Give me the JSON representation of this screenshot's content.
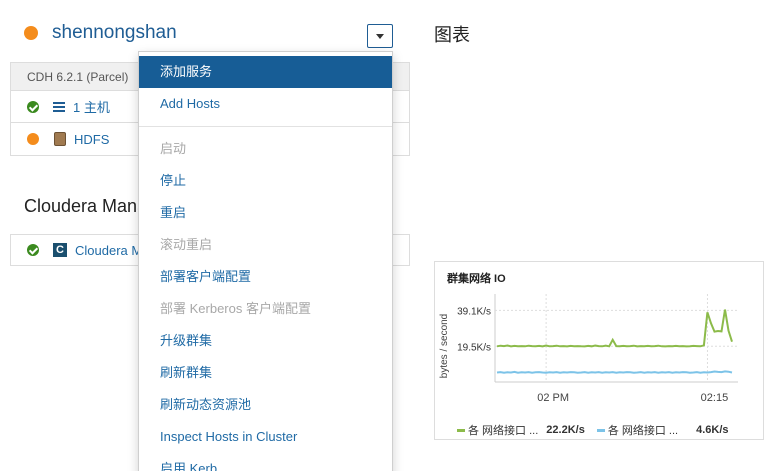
{
  "cluster": {
    "name": "shennongshan",
    "status_color": "#f48c1c",
    "version": "CDH 6.2.1 (Parcel)"
  },
  "services": [
    {
      "label": "1 主机",
      "status": "good",
      "icon": "list-icon"
    },
    {
      "label": "HDFS",
      "status": "warning",
      "icon": "hdfs-icon"
    }
  ],
  "cloudera_manager": {
    "title": "Cloudera Mana",
    "service_label": "Cloudera M",
    "icon_letter": "C"
  },
  "menu": {
    "items": [
      {
        "label": "添加服务",
        "state": "active"
      },
      {
        "label": "Add Hosts",
        "state": "enabled"
      },
      {
        "label": "启动",
        "state": "disabled"
      },
      {
        "label": "停止",
        "state": "enabled"
      },
      {
        "label": "重启",
        "state": "enabled"
      },
      {
        "label": "滚动重启",
        "state": "disabled"
      },
      {
        "label": "部署客户端配置",
        "state": "enabled"
      },
      {
        "label": "部署 Kerberos 客户端配置",
        "state": "disabled"
      },
      {
        "label": "升级群集",
        "state": "enabled"
      },
      {
        "label": "刷新群集",
        "state": "enabled"
      },
      {
        "label": "刷新动态资源池",
        "state": "enabled"
      },
      {
        "label": "Inspect Hosts in Cluster",
        "state": "enabled"
      },
      {
        "label": "启用 Kerb",
        "state": "enabled"
      }
    ]
  },
  "charts": {
    "title": "图表"
  },
  "chart_data": {
    "type": "line",
    "title": "群集网络 IO",
    "ylabel": "bytes / second",
    "y_ticks": [
      "39.1K/s",
      "19.5K/s"
    ],
    "x_ticks": [
      "02 PM",
      "02:15"
    ],
    "series": [
      {
        "name": "各 网络接口 ...",
        "total": "22.2K/s",
        "color": "#8cbb4a",
        "values": [
          19.5,
          19.8,
          19.6,
          19.9,
          19.4,
          19.7,
          19.5,
          19.6,
          19.5,
          19.8,
          19.6,
          19.5,
          19.7,
          19.4,
          19.9,
          19.5,
          19.6,
          19.8,
          19.5,
          19.6,
          19.4,
          19.7,
          19.5,
          19.6,
          19.5,
          19.4,
          19.7,
          19.5,
          19.9,
          19.6,
          19.5,
          19.8,
          19.5,
          23.0,
          19.6,
          19.5,
          19.7,
          19.5,
          19.6,
          19.8,
          19.4,
          19.6,
          19.5,
          19.7,
          19.5,
          19.6,
          19.8,
          19.5,
          19.4,
          19.6,
          19.5,
          19.7,
          19.5,
          19.6,
          19.4,
          19.5,
          19.7,
          19.6,
          19.5,
          20.0,
          38.0,
          32.0,
          27.5,
          27.8,
          27.6,
          39.5,
          28.0,
          22.0
        ]
      },
      {
        "name": "各 网络接口 ...",
        "total": "4.6K/s",
        "color": "#7cc3e8",
        "values": [
          5.2,
          5.4,
          5.1,
          5.3,
          5.2,
          5.5,
          5.1,
          5.3,
          5.2,
          5.4,
          5.1,
          5.3,
          5.4,
          5.2,
          5.1,
          5.3,
          5.2,
          5.4,
          5.1,
          5.3,
          5.2,
          5.4,
          5.3,
          5.1,
          5.2,
          5.4,
          5.1,
          5.3,
          5.2,
          5.4,
          5.1,
          5.3,
          5.2,
          5.4,
          5.1,
          5.3,
          5.2,
          5.4,
          5.3,
          5.1,
          5.2,
          5.4,
          5.1,
          5.3,
          5.2,
          5.4,
          5.1,
          5.3,
          5.2,
          5.4,
          5.1,
          5.3,
          5.2,
          5.4,
          5.3,
          5.1,
          5.2,
          5.4,
          5.1,
          5.3,
          5.2,
          5.4,
          5.7,
          5.5,
          5.4,
          5.8,
          5.6,
          5.2
        ]
      }
    ],
    "ylim": [
      0,
      48
    ],
    "grid": true,
    "legend_position": "bottom"
  }
}
